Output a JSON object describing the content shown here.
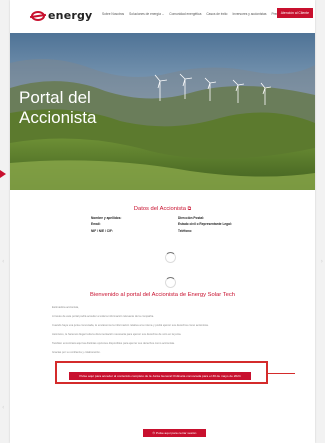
{
  "header": {
    "logo_text": "energy",
    "nav": [
      {
        "label": "Sobre Nosotros",
        "has_dropdown": false
      },
      {
        "label": "Soluciones de energía",
        "has_dropdown": true
      },
      {
        "label": "Comunidad energética",
        "has_dropdown": false
      },
      {
        "label": "Casos de éxito",
        "has_dropdown": false
      },
      {
        "label": "Inversores y accionistas",
        "has_dropdown": false
      },
      {
        "label": "Prensa",
        "has_dropdown": false
      }
    ],
    "cta_label": "Atención al Cliente"
  },
  "hero": {
    "title_line1": "Portal del",
    "title_line2": "Accionista"
  },
  "datos": {
    "title": "Datos del Accionista",
    "left": [
      "Nombre y apellidos:",
      "Email:",
      "NIF / NIE / CIF:"
    ],
    "right": [
      "Dirección Postal:",
      "Estado civil o Representante Legal:",
      "Teléfono:"
    ]
  },
  "welcome": {
    "title": "Bienvenido al portal del Accionista de Energy Solar Tech",
    "paragraphs": [
      "Estimado/a accionista,",
      "A través de este portal podrá acceder a toda la información relevante de la compañía.",
      "Cuando haya una junta convocada, le enviaremos la información relativa a la misma y podrá ejercer sus derechos como accionista.",
      "Asimismo, le haremos llegar toda la documentación necesaria para ejercer sus derechos de voto en la junta.",
      "También encontrará aquí las distintas opciones disponibles para ejercer sus derechos como accionista.",
      "Gracias por su confianza y colaboración."
    ]
  },
  "actions": {
    "junta_button": "Pulse aquí para acceder al contenido completo de la Junta General Ordinaria convocada para el 30 de mayo de 2024",
    "salir_button": "Pulse aquí para cerrar sesión"
  },
  "colors": {
    "accent": "#c8102e",
    "highlight_border": "#d42b2b"
  },
  "icons": {
    "external_link": "external-link-icon",
    "logout": "logout-icon"
  }
}
